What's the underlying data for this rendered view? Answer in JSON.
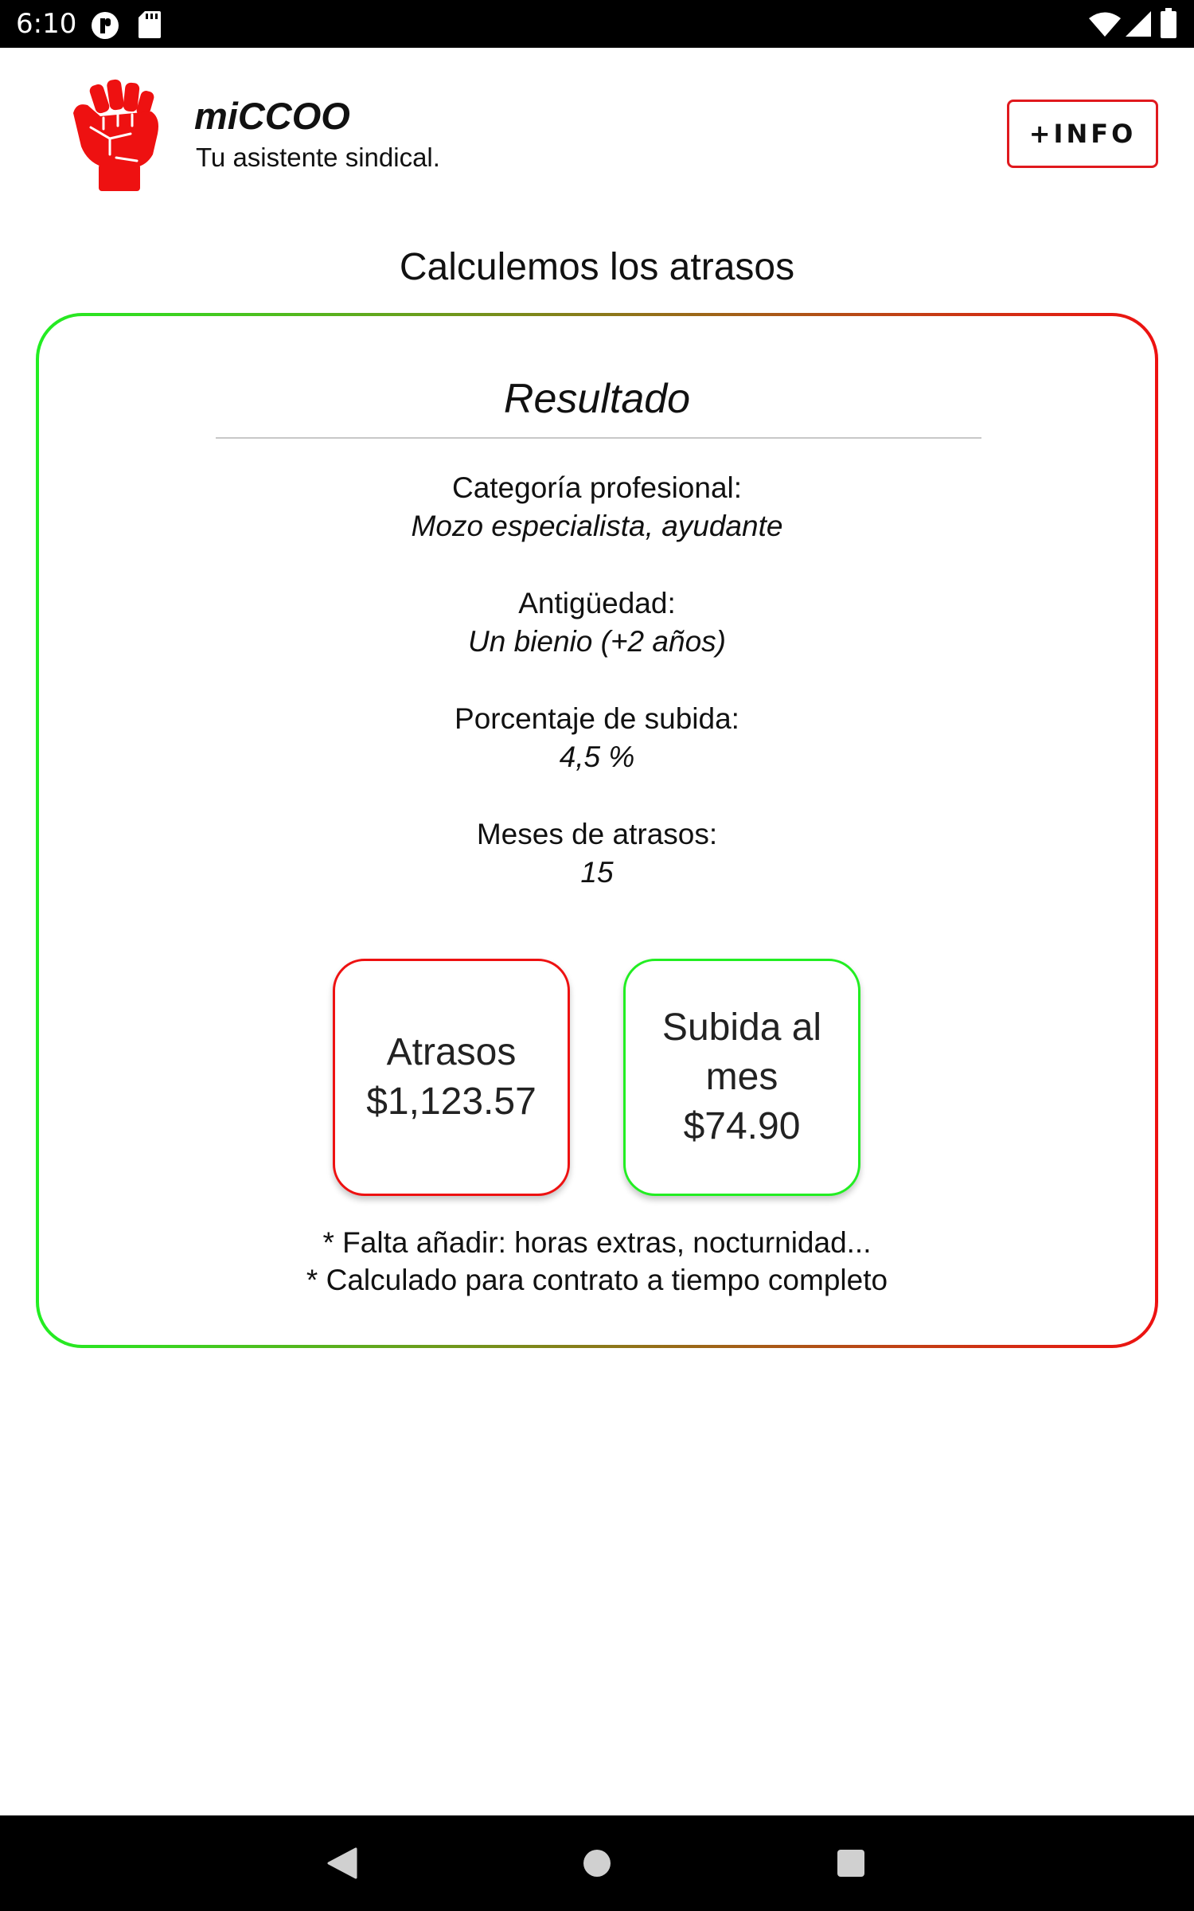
{
  "status_bar": {
    "time": "6:10",
    "icons": [
      "app-notification-icon",
      "sd-card-icon",
      "wifi-icon",
      "signal-icon",
      "battery-icon"
    ]
  },
  "header": {
    "logo_icon": "raised-fist-icon",
    "app_name": "miCCOO",
    "tagline": "Tu asistente sindical.",
    "info_button_label": "+INFO"
  },
  "page": {
    "heading": "Calculemos los atrasos"
  },
  "result": {
    "title": "Resultado",
    "fields": [
      {
        "label": "Categoría profesional:",
        "value": "Mozo especialista, ayudante"
      },
      {
        "label": "Antigüedad:",
        "value": "Un bienio (+2 años)"
      },
      {
        "label": "Porcentaje de subida:",
        "value": "4,5 %"
      },
      {
        "label": "Meses de atrasos:",
        "value": "15"
      }
    ],
    "boxes": {
      "arrears": {
        "label": "Atrasos",
        "amount": "$1,123.57"
      },
      "monthly_raise": {
        "label_line1": "Subida al",
        "label_line2": "mes",
        "amount": "$74.90"
      }
    },
    "notes": [
      "* Falta añadir: horas extras, nocturnidad...",
      "* Calculado para contrato a tiempo completo"
    ]
  },
  "nav_bar": {
    "icons": [
      "back-icon",
      "home-icon",
      "recents-icon"
    ]
  },
  "colors": {
    "accent_red": "#ee1111",
    "accent_green": "#22ee22",
    "logo_red": "#ee1111"
  }
}
